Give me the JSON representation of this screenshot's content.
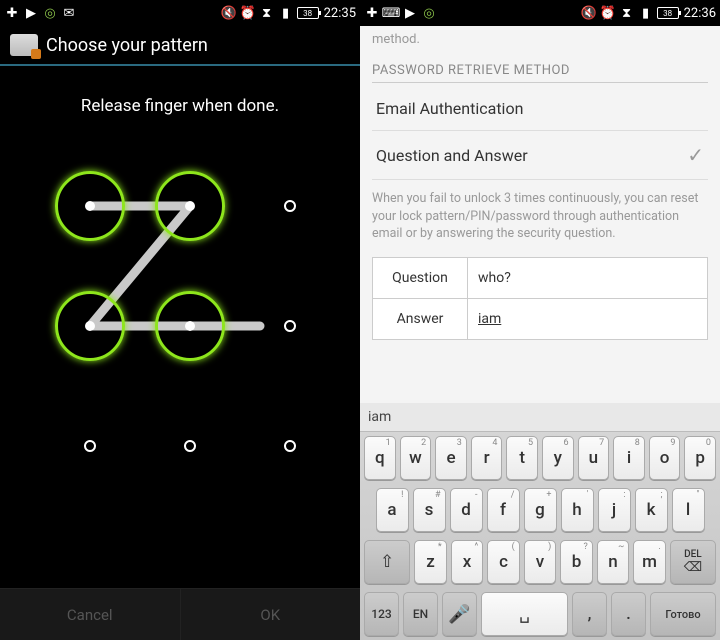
{
  "left": {
    "status": {
      "icons_left": [
        "plus",
        "play",
        "target",
        "mail"
      ],
      "icons_right": [
        "mute",
        "alarm",
        "wifi",
        "signal"
      ],
      "battery": "38",
      "time": "22:35"
    },
    "title": "Choose your pattern",
    "instruction": "Release finger when done.",
    "pattern": {
      "grid": 3,
      "selected": [
        0,
        1,
        3,
        4
      ],
      "path": [
        0,
        1,
        3,
        4
      ]
    },
    "cancel": "Cancel",
    "ok": "OK"
  },
  "right": {
    "status": {
      "icons_left": [
        "plus",
        "keyboard",
        "play",
        "target"
      ],
      "icons_right": [
        "mute",
        "alarm",
        "wifi",
        "signal"
      ],
      "battery": "38",
      "time": "22:36"
    },
    "top_fragment": "method.",
    "section_header": "PASSWORD RETRIEVE METHOD",
    "options": [
      {
        "label": "Email Authentication",
        "checked": false
      },
      {
        "label": "Question and Answer",
        "checked": true
      }
    ],
    "description": "When you fail to unlock 3 times continuously, you can reset your lock pattern/PIN/password through authentication email or by answering the security question.",
    "question_label": "Question",
    "question_value": "who?",
    "answer_label": "Answer",
    "answer_value": "iam",
    "keyboard": {
      "suggestion": "iam",
      "row1": [
        {
          "m": "q",
          "s": "1"
        },
        {
          "m": "w",
          "s": "2"
        },
        {
          "m": "e",
          "s": "3"
        },
        {
          "m": "r",
          "s": "4"
        },
        {
          "m": "t",
          "s": "5"
        },
        {
          "m": "y",
          "s": "6"
        },
        {
          "m": "u",
          "s": "7"
        },
        {
          "m": "i",
          "s": "8"
        },
        {
          "m": "o",
          "s": "9"
        },
        {
          "m": "p",
          "s": "0"
        }
      ],
      "row2": [
        {
          "m": "a",
          "s": "!"
        },
        {
          "m": "s",
          "s": "#"
        },
        {
          "m": "d",
          "s": "-"
        },
        {
          "m": "f",
          "s": "/"
        },
        {
          "m": "g",
          "s": "+"
        },
        {
          "m": "h",
          "s": "'"
        },
        {
          "m": "j",
          "s": ":"
        },
        {
          "m": "k",
          "s": ";"
        },
        {
          "m": "l",
          "s": "\""
        }
      ],
      "row3": [
        {
          "m": "z",
          "s": "*"
        },
        {
          "m": "x",
          "s": "^"
        },
        {
          "m": "c",
          "s": "("
        },
        {
          "m": "v",
          "s": ")"
        },
        {
          "m": "b",
          "s": "?"
        },
        {
          "m": "n",
          "s": "~"
        },
        {
          "m": "m",
          "s": "."
        }
      ],
      "shift": "⇧",
      "del": "DEL",
      "num": "123",
      "lang": "EN",
      "mic": "🎤",
      "comma": ",",
      "period": ".",
      "done": "Готово"
    }
  }
}
